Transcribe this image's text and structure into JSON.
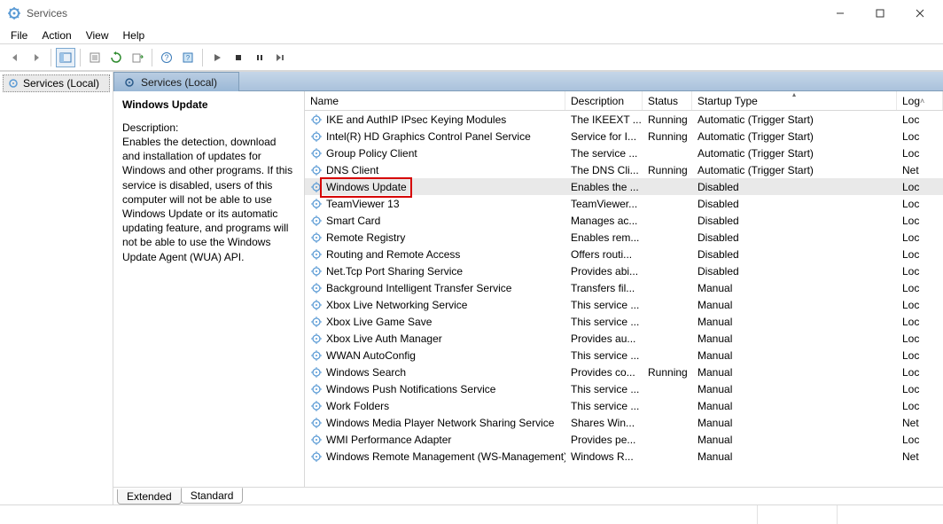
{
  "window": {
    "title": "Services"
  },
  "menu": {
    "file": "File",
    "action": "Action",
    "view": "View",
    "help": "Help"
  },
  "tree": {
    "root": "Services (Local)"
  },
  "content": {
    "header": "Services (Local)",
    "selected": {
      "name": "Windows Update",
      "desc_label": "Description:",
      "desc": "Enables the detection, download and installation of updates for Windows and other programs. If this service is disabled, users of this computer will not be able to use Windows Update or its automatic updating feature, and programs will not be able to use the Windows Update Agent (WUA) API."
    }
  },
  "columns": {
    "name": "Name",
    "desc": "Description",
    "status": "Status",
    "startup": "Startup Type",
    "logon": "Log"
  },
  "rows": [
    {
      "name": "IKE and AuthIP IPsec Keying Modules",
      "desc": "The IKEEXT ...",
      "status": "Running",
      "startup": "Automatic (Trigger Start)",
      "logon": "Loc"
    },
    {
      "name": "Intel(R) HD Graphics Control Panel Service",
      "desc": "Service for I...",
      "status": "Running",
      "startup": "Automatic (Trigger Start)",
      "logon": "Loc"
    },
    {
      "name": "Group Policy Client",
      "desc": "The service ...",
      "status": "",
      "startup": "Automatic (Trigger Start)",
      "logon": "Loc"
    },
    {
      "name": "DNS Client",
      "desc": "The DNS Cli...",
      "status": "Running",
      "startup": "Automatic (Trigger Start)",
      "logon": "Net"
    },
    {
      "name": "Windows Update",
      "desc": "Enables the ...",
      "status": "",
      "startup": "Disabled",
      "logon": "Loc",
      "selected": true,
      "highlight": true
    },
    {
      "name": "TeamViewer 13",
      "desc": "TeamViewer...",
      "status": "",
      "startup": "Disabled",
      "logon": "Loc"
    },
    {
      "name": "Smart Card",
      "desc": "Manages ac...",
      "status": "",
      "startup": "Disabled",
      "logon": "Loc"
    },
    {
      "name": "Remote Registry",
      "desc": "Enables rem...",
      "status": "",
      "startup": "Disabled",
      "logon": "Loc"
    },
    {
      "name": "Routing and Remote Access",
      "desc": "Offers routi...",
      "status": "",
      "startup": "Disabled",
      "logon": "Loc"
    },
    {
      "name": "Net.Tcp Port Sharing Service",
      "desc": "Provides abi...",
      "status": "",
      "startup": "Disabled",
      "logon": "Loc"
    },
    {
      "name": "Background Intelligent Transfer Service",
      "desc": "Transfers fil...",
      "status": "",
      "startup": "Manual",
      "logon": "Loc"
    },
    {
      "name": "Xbox Live Networking Service",
      "desc": "This service ...",
      "status": "",
      "startup": "Manual",
      "logon": "Loc"
    },
    {
      "name": "Xbox Live Game Save",
      "desc": "This service ...",
      "status": "",
      "startup": "Manual",
      "logon": "Loc"
    },
    {
      "name": "Xbox Live Auth Manager",
      "desc": "Provides au...",
      "status": "",
      "startup": "Manual",
      "logon": "Loc"
    },
    {
      "name": "WWAN AutoConfig",
      "desc": "This service ...",
      "status": "",
      "startup": "Manual",
      "logon": "Loc"
    },
    {
      "name": "Windows Search",
      "desc": "Provides co...",
      "status": "Running",
      "startup": "Manual",
      "logon": "Loc"
    },
    {
      "name": "Windows Push Notifications Service",
      "desc": "This service ...",
      "status": "",
      "startup": "Manual",
      "logon": "Loc"
    },
    {
      "name": "Work Folders",
      "desc": "This service ...",
      "status": "",
      "startup": "Manual",
      "logon": "Loc"
    },
    {
      "name": "Windows Media Player Network Sharing Service",
      "desc": "Shares Win...",
      "status": "",
      "startup": "Manual",
      "logon": "Net"
    },
    {
      "name": "WMI Performance Adapter",
      "desc": "Provides pe...",
      "status": "",
      "startup": "Manual",
      "logon": "Loc"
    },
    {
      "name": "Windows Remote Management (WS-Management)",
      "desc": "Windows R...",
      "status": "",
      "startup": "Manual",
      "logon": "Net"
    }
  ],
  "tabs": {
    "extended": "Extended",
    "standard": "Standard"
  }
}
